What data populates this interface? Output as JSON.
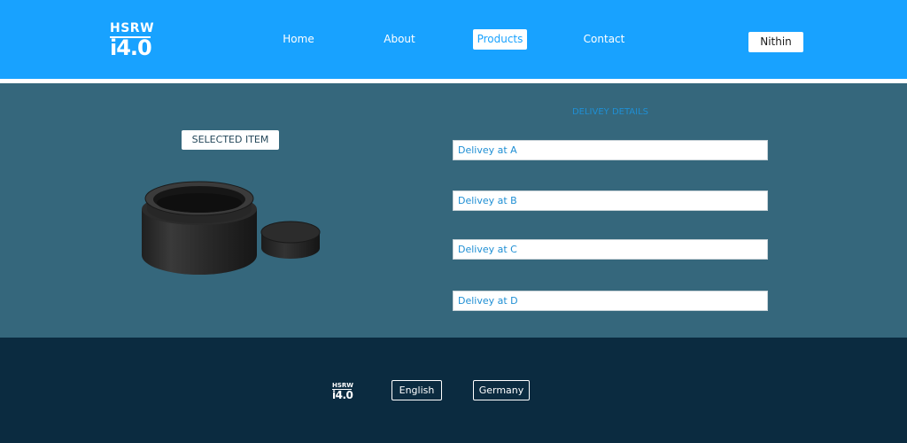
{
  "header": {
    "logo_top": "HSRW",
    "logo_bottom": "i4.0",
    "nav": [
      {
        "label": "Home"
      },
      {
        "label": "About"
      },
      {
        "label": "Products"
      },
      {
        "label": "Contact"
      }
    ],
    "active_nav": "Products",
    "user_name": "Nithin"
  },
  "main": {
    "selected_item_label": "SELECTED ITEM",
    "delivery_title": "DELIVEY DETAILS",
    "delivery_options": [
      {
        "label": "Delivey at A"
      },
      {
        "label": "Delivey at B"
      },
      {
        "label": "Delivey at C"
      },
      {
        "label": "Delivey at D"
      }
    ]
  },
  "footer": {
    "logo_top": "HSRW",
    "logo_bottom": "i4.0",
    "languages": [
      {
        "label": "English"
      },
      {
        "label": "Germany"
      }
    ]
  },
  "colors": {
    "header_bg": "#18a2ff",
    "main_bg": "#35677c",
    "footer_bg": "#0b2b40",
    "accent_text": "#1f8fd4"
  }
}
